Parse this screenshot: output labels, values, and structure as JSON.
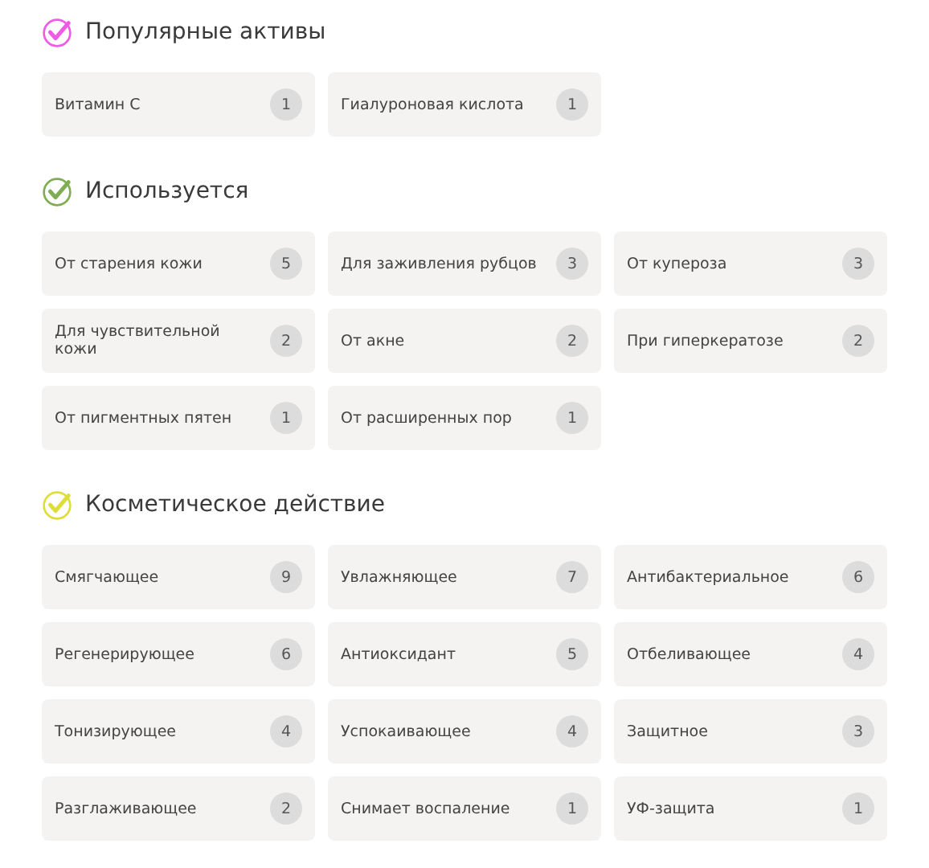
{
  "sections": [
    {
      "title": "Популярные активы",
      "color": "#f05ae6",
      "items": [
        {
          "label": "Витамин С",
          "count": "1"
        },
        {
          "label": "Гиалуроновая кислота",
          "count": "1"
        }
      ]
    },
    {
      "title": "Используется",
      "color": "#7fae52",
      "items": [
        {
          "label": "От старения кожи",
          "count": "5"
        },
        {
          "label": "Для заживления рубцов",
          "count": "3"
        },
        {
          "label": "От купероза",
          "count": "3"
        },
        {
          "label": "Для чувствительной кожи",
          "count": "2"
        },
        {
          "label": "От акне",
          "count": "2"
        },
        {
          "label": "При гиперкератозе",
          "count": "2"
        },
        {
          "label": "От пигментных пятен",
          "count": "1"
        },
        {
          "label": "От расширенных пор",
          "count": "1"
        }
      ]
    },
    {
      "title": "Косметическое действие",
      "color": "#dede3a",
      "items": [
        {
          "label": "Смягчающее",
          "count": "9"
        },
        {
          "label": "Увлажняющее",
          "count": "7"
        },
        {
          "label": "Антибактериальное",
          "count": "6"
        },
        {
          "label": "Регенерирующее",
          "count": "6"
        },
        {
          "label": "Антиоксидант",
          "count": "5"
        },
        {
          "label": "Отбеливающее",
          "count": "4"
        },
        {
          "label": "Тонизирующее",
          "count": "4"
        },
        {
          "label": "Успокаивающее",
          "count": "4"
        },
        {
          "label": "Защитное",
          "count": "3"
        },
        {
          "label": "Разглаживающее",
          "count": "2"
        },
        {
          "label": "Снимает воспаление",
          "count": "1"
        },
        {
          "label": "УФ-защита",
          "count": "1"
        }
      ]
    }
  ]
}
